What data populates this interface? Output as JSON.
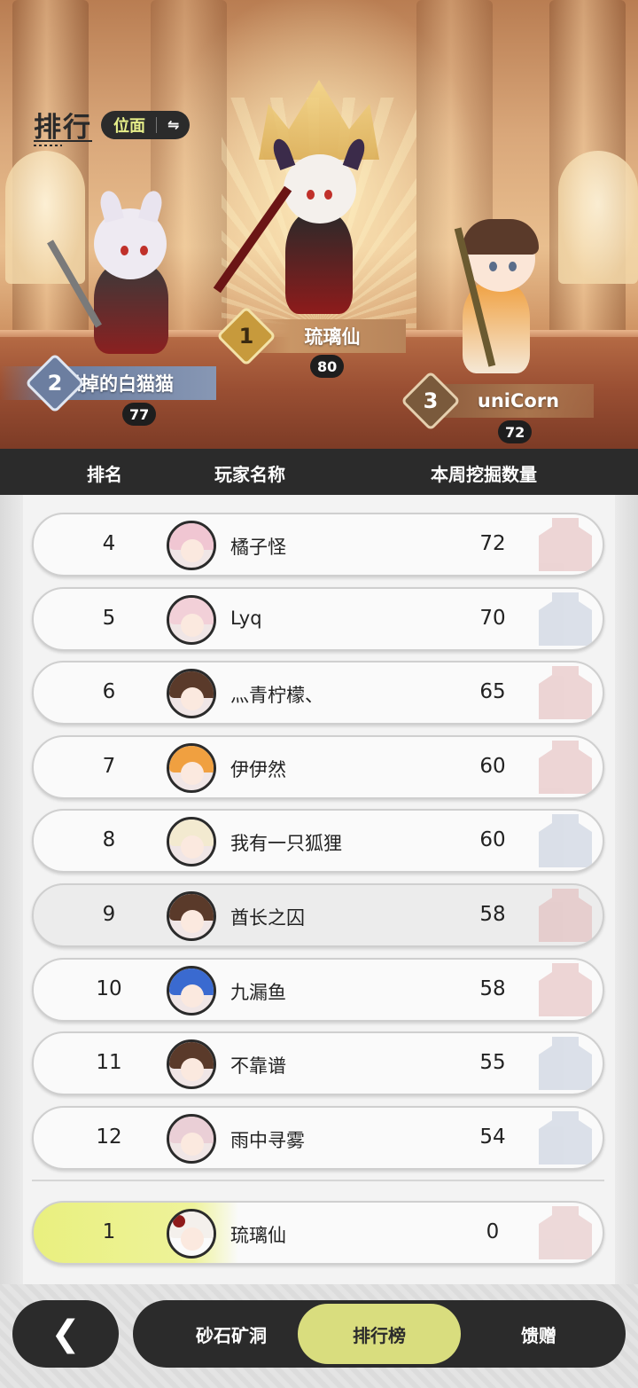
{
  "header": {
    "title": "排行",
    "plane_label": "位面",
    "swap_icon": "swap-arrows-icon"
  },
  "podium": [
    {
      "rank": "1",
      "name": "琉璃仙",
      "score": "80"
    },
    {
      "rank": "2",
      "name": "似掉的白猫猫",
      "score": "77"
    },
    {
      "rank": "3",
      "name": "uniCorn",
      "score": "72"
    }
  ],
  "table_header": {
    "rank": "排名",
    "player": "玩家名称",
    "score": "本周挖掘数量"
  },
  "rows": [
    {
      "rank": "4",
      "name": "橘子怪",
      "score": "72"
    },
    {
      "rank": "5",
      "name": "Lyq",
      "score": "70"
    },
    {
      "rank": "6",
      "name": "灬青柠檬、",
      "score": "65"
    },
    {
      "rank": "7",
      "name": "伊伊然",
      "score": "60"
    },
    {
      "rank": "8",
      "name": "我有一只狐狸",
      "score": "60"
    },
    {
      "rank": "9",
      "name": "酋长之囚",
      "score": "58"
    },
    {
      "rank": "10",
      "name": "九漏鱼",
      "score": "58"
    },
    {
      "rank": "11",
      "name": "不靠谱",
      "score": "55"
    },
    {
      "rank": "12",
      "name": "雨中寻雾",
      "score": "54"
    }
  ],
  "self_row": {
    "rank": "1",
    "name": "琉璃仙",
    "score": "0"
  },
  "nav": {
    "back_icon": "chevron-left-icon",
    "tabs": [
      "砂石矿洞",
      "排行榜",
      "馈赠"
    ],
    "active_tab": "排行榜"
  },
  "colors": {
    "accent": "#d9dd7e",
    "dark": "#2b2b2b"
  }
}
